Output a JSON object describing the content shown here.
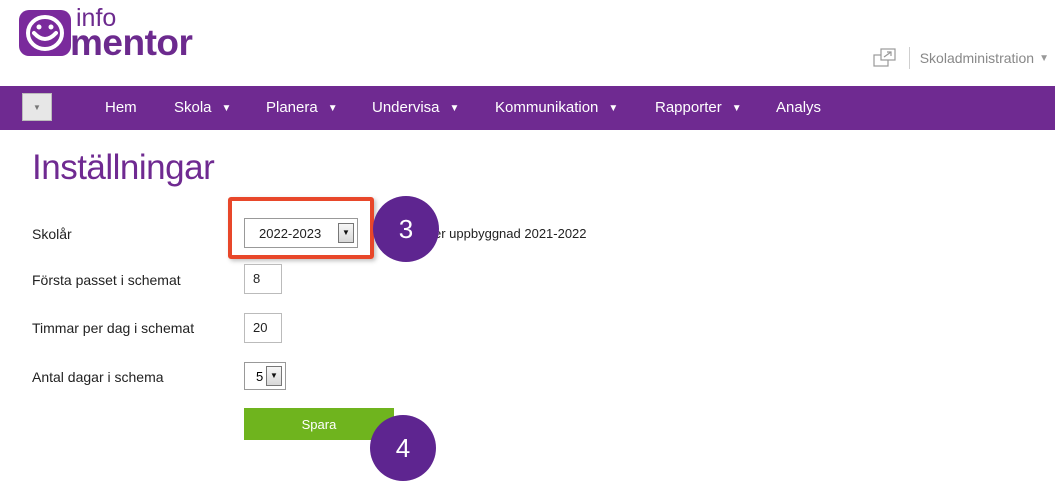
{
  "header": {
    "logo_info": "info",
    "logo_mentor": "mentor",
    "role_label": "Skoladministration"
  },
  "nav": {
    "items": [
      {
        "label": "Hem",
        "has_caret": false
      },
      {
        "label": "Skola",
        "has_caret": true
      },
      {
        "label": "Planera",
        "has_caret": true
      },
      {
        "label": "Undervisa",
        "has_caret": true
      },
      {
        "label": "Kommunikation",
        "has_caret": true
      },
      {
        "label": "Rapporter",
        "has_caret": true
      },
      {
        "label": "Analys",
        "has_caret": false
      }
    ],
    "caret": "▼"
  },
  "page": {
    "title": "Inställningar",
    "fields": {
      "school_year": {
        "label": "Skolår",
        "value": "2022-2023"
      },
      "first_period": {
        "label": "Första passet i schemat",
        "value": "8"
      },
      "hours_per_day": {
        "label": "Timmar per dag i schemat",
        "value": "20"
      },
      "days_in_schedule": {
        "label": "Antal dagar i schema",
        "value": "5"
      }
    },
    "note": "er uppbyggnad 2021-2022",
    "save_label": "Spara"
  },
  "annotations": {
    "step_3": "3",
    "step_4": "4",
    "highlight_color": "#e8472a",
    "badge_color": "#5e2590"
  },
  "colors": {
    "brand_purple": "#6f2a91",
    "save_green": "#6fb41e"
  },
  "icons": {
    "logo": "smiley-face-icon",
    "switch": "window-switch-icon",
    "dropdown": "triangle-down-icon"
  }
}
